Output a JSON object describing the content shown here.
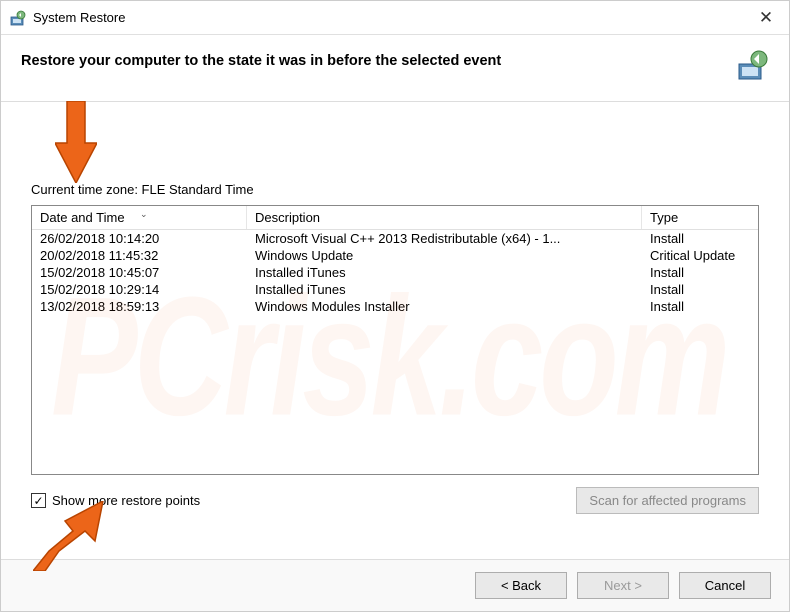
{
  "window": {
    "title": "System Restore",
    "close": "✕"
  },
  "header": {
    "heading": "Restore your computer to the state it was in before the selected event"
  },
  "timezone_label": "Current time zone: FLE Standard Time",
  "columns": {
    "date": "Date and Time",
    "desc": "Description",
    "type": "Type"
  },
  "rows": [
    {
      "date": "26/02/2018 10:14:20",
      "desc": "Microsoft Visual C++ 2013 Redistributable (x64) - 1...",
      "type": "Install"
    },
    {
      "date": "20/02/2018 11:45:32",
      "desc": "Windows Update",
      "type": "Critical Update"
    },
    {
      "date": "15/02/2018 10:45:07",
      "desc": "Installed iTunes",
      "type": "Install"
    },
    {
      "date": "15/02/2018 10:29:14",
      "desc": "Installed iTunes",
      "type": "Install"
    },
    {
      "date": "13/02/2018 18:59:13",
      "desc": "Windows Modules Installer",
      "type": "Install"
    }
  ],
  "checkbox": {
    "label": "Show more restore points",
    "checked": true
  },
  "scan_button": "Scan for affected programs",
  "buttons": {
    "back": "< Back",
    "next": "Next >",
    "cancel": "Cancel"
  },
  "annotations": {
    "arrow1": "orange-arrow-down",
    "arrow2": "orange-arrow-up-right"
  }
}
